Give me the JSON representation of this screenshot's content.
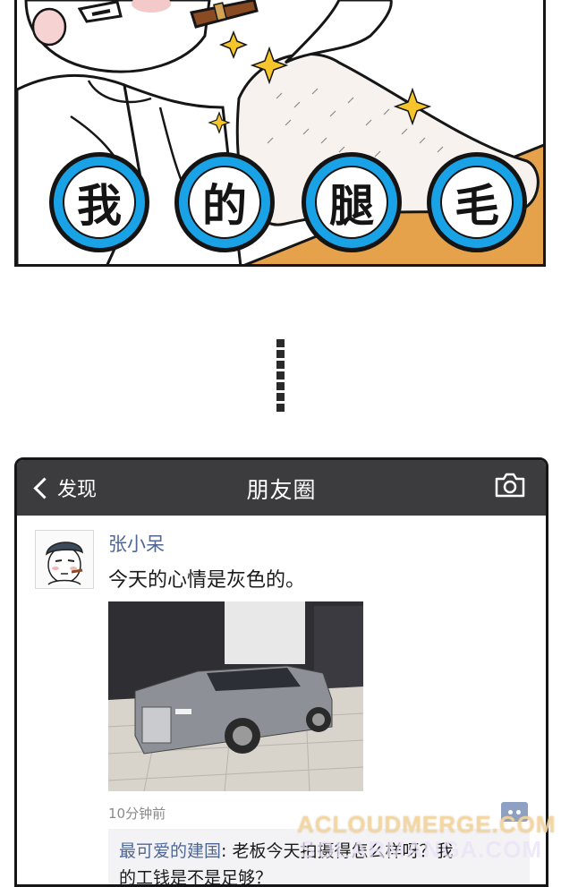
{
  "comic": {
    "bubbles": [
      "我",
      "的",
      "腿",
      "毛"
    ]
  },
  "moments": {
    "back_label": "发现",
    "title": "朋友圈",
    "camera_icon": "camera-icon",
    "post": {
      "user_name": "张小呆",
      "text": "今天的心情是灰色的。",
      "time": "10分钟前",
      "comment": {
        "author": "最可爱的建国",
        "text": ": 老板今天拍摄得怎么样呀？我",
        "text_line2": "的工钱是不是足够？"
      }
    }
  },
  "watermark": {
    "line1": "ACLOUDMERGE.COM",
    "line2": "SOLARMANGA.COM"
  },
  "colors": {
    "bubble_blue": "#1aa2e6",
    "nav_bar": "#3c3c3e",
    "link_blue": "#4f6796"
  }
}
